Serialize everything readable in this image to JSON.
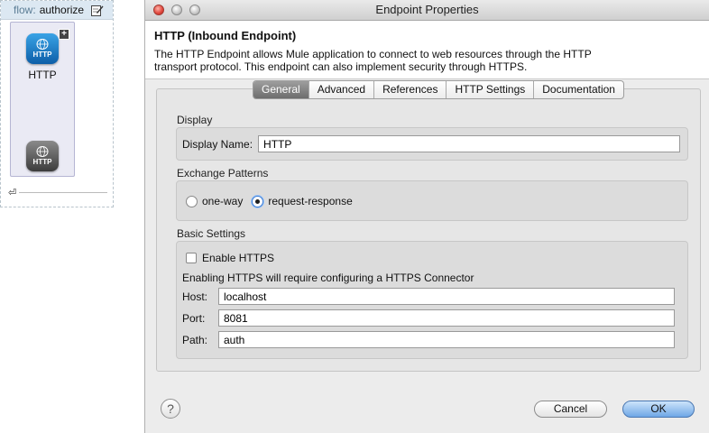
{
  "flow": {
    "prefix": "flow:",
    "name": "authorize",
    "icon": "edit-icon",
    "plus_badge": "+",
    "endpoint_label": "HTTP",
    "blue_icon_text": "HTTP",
    "gray_icon_text": "HTTP",
    "bottom_marker": "⏎"
  },
  "window": {
    "title": "Endpoint Properties"
  },
  "description": {
    "title": "HTTP (Inbound Endpoint)",
    "text": "The HTTP Endpoint allows Mule application to connect to web resources through the HTTP transport protocol. This endpoint can also implement security through HTTPS."
  },
  "tabs": [
    {
      "label": "General",
      "active": true
    },
    {
      "label": "Advanced",
      "active": false
    },
    {
      "label": "References",
      "active": false
    },
    {
      "label": "HTTP Settings",
      "active": false
    },
    {
      "label": "Documentation",
      "active": false
    }
  ],
  "display": {
    "section_label": "Display",
    "display_name_label": "Display Name:",
    "display_name_value": "HTTP"
  },
  "exchange": {
    "section_label": "Exchange Patterns",
    "options": [
      {
        "label": "one-way",
        "selected": false
      },
      {
        "label": "request-response",
        "selected": true
      }
    ]
  },
  "basic": {
    "section_label": "Basic Settings",
    "enable_https_label": "Enable HTTPS",
    "enable_https_checked": false,
    "https_note": "Enabling HTTPS will require configuring a HTTPS Connector",
    "host_label": "Host:",
    "host_value": "localhost",
    "port_label": "Port:",
    "port_value": "8081",
    "path_label": "Path:",
    "path_value": "auth"
  },
  "footer": {
    "help_symbol": "?",
    "cancel_label": "Cancel",
    "ok_label": "OK"
  },
  "colors": {
    "ok_button": "#6fa7e6",
    "active_tab": "#7d7d7d",
    "http_blue": "#1a7ac8"
  }
}
